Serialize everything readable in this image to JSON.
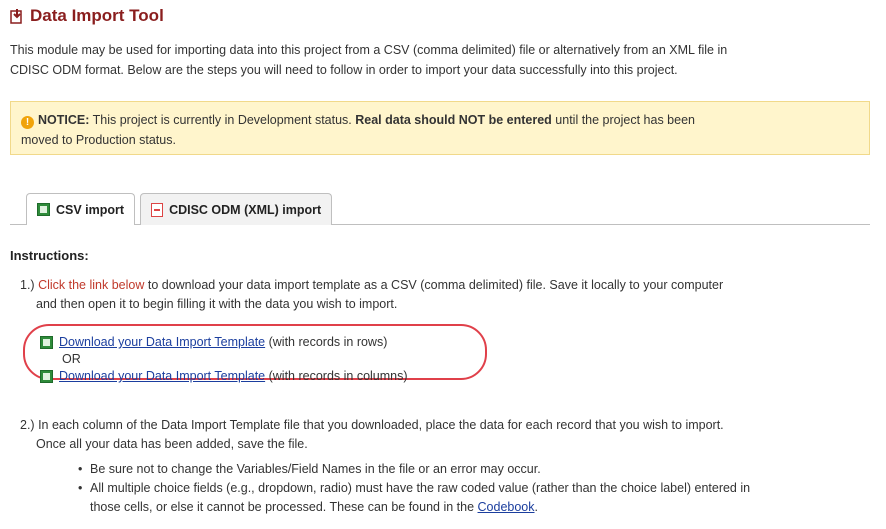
{
  "title": "Data Import Tool",
  "intro": {
    "line1": "This module may be used for importing data into this project from a CSV (comma delimited) file or alternatively from an XML file in",
    "line2": "CDISC ODM format. Below are the steps you will need to follow in order to import your data successfully into this project."
  },
  "notice": {
    "label": "NOTICE:",
    "text1": " This project is currently in Development status. ",
    "bold": "Real data should NOT be entered",
    "text2": " until the project has been",
    "line2": "moved to Production status."
  },
  "tabs": [
    {
      "label": "CSV import"
    },
    {
      "label": "CDISC ODM (XML) import"
    }
  ],
  "instructions": {
    "heading": "Instructions:",
    "step1": {
      "num": "1.)",
      "link_text": "Click the link below",
      "text1": " to download your data import template as a CSV (comma delimited) file. Save it locally to your computer",
      "line2": "and then open it to begin filling it with the data you wish to import."
    },
    "download1": {
      "link": "Download your Data Import Template",
      "suffix": " (with records in rows)"
    },
    "or": "OR",
    "download2": {
      "link": "Download your Data Import Template",
      "suffix": " (with records in columns)"
    },
    "step2": {
      "num": "2.)",
      "text": "In each column of the Data Import Template file that you downloaded, place the data for each record that you wish to import.",
      "line2": "Once all your data has been added, save the file."
    },
    "bullets": [
      {
        "text": "Be sure not to change the Variables/Field Names in the file or an error may occur."
      },
      {
        "text": "All multiple choice fields (e.g., dropdown, radio) must have the raw coded value (rather than the choice label) entered in",
        "line2": "those cells, or else it cannot be processed. These can be found in the ",
        "link": "Codebook",
        "end": "."
      }
    ]
  }
}
